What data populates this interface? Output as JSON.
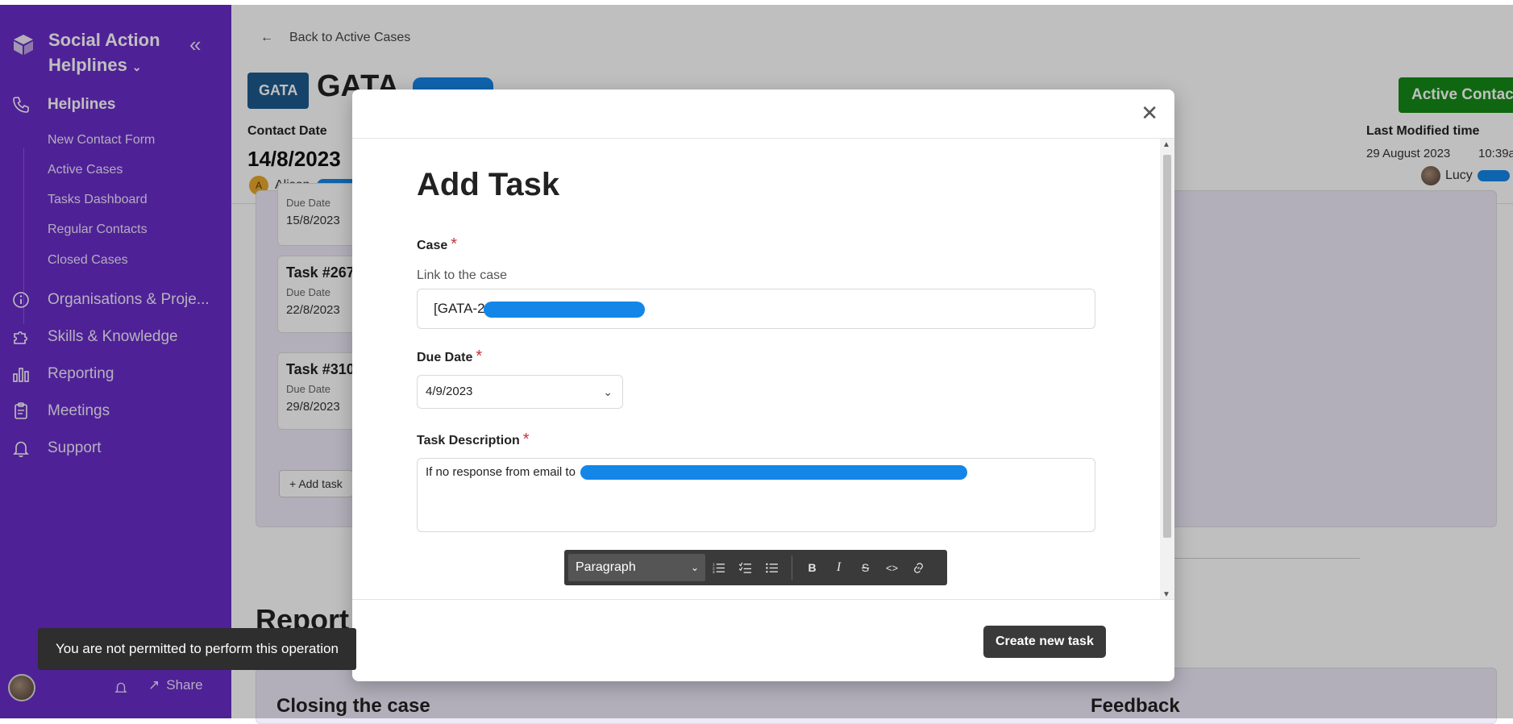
{
  "sidebar": {
    "brand_line1": "Social Action",
    "brand_line2": "Helplines",
    "nav": [
      {
        "label": "Helplines",
        "icon": "phone-icon"
      },
      {
        "label": "Organisations & Proje...",
        "icon": "info-icon"
      },
      {
        "label": "Skills & Knowledge",
        "icon": "puzzle-icon"
      },
      {
        "label": "Reporting",
        "icon": "bar-chart-icon"
      },
      {
        "label": "Meetings",
        "icon": "clipboard-icon"
      },
      {
        "label": "Support",
        "icon": "bell-icon"
      }
    ],
    "subnav": [
      "New Contact Form",
      "Active Cases",
      "Tasks Dashboard",
      "Regular Contacts",
      "Closed Cases"
    ],
    "share_label": "Share"
  },
  "page": {
    "back_label": "Back to Active Cases",
    "badge": "GATA",
    "title": "GATA",
    "contact_date_label": "Contact Date",
    "contact_date": "14/8/2023",
    "owner_initial": "A",
    "owner_name": "Alison",
    "status_button": "Active Contact",
    "last_modified_label": "Last Modified time",
    "last_modified_date": "29 August 2023",
    "last_modified_time": "10:39a",
    "last_modified_user": "Lucy",
    "tasks": [
      {
        "title": "",
        "due_label": "Due Date",
        "due": "15/8/2023"
      },
      {
        "title": "Task #267",
        "due_label": "Due Date",
        "due": "22/8/2023"
      },
      {
        "title": "Task #310",
        "due_label": "Due Date",
        "due": "29/8/2023"
      }
    ],
    "add_task_label": "Add task",
    "reports_title": "Report",
    "closing_title": "Closing the case",
    "feedback_title": "Feedback"
  },
  "modal": {
    "title": "Add Task",
    "case_label": "Case",
    "case_help": "Link to the case",
    "case_value": "[GATA-2",
    "due_label": "Due Date",
    "due_value": "4/9/2023",
    "desc_label": "Task Description",
    "desc_value": "If no response from email to",
    "toolbar_block_type": "Paragraph",
    "create_button": "Create new task"
  },
  "toast": "You are not permitted to perform this operation",
  "colors": {
    "sidebar": "#6a2cc8",
    "active_contact": "#168a17",
    "badge": "#1e5a8c",
    "required": "#c0343c",
    "redaction": "#1486e8"
  }
}
